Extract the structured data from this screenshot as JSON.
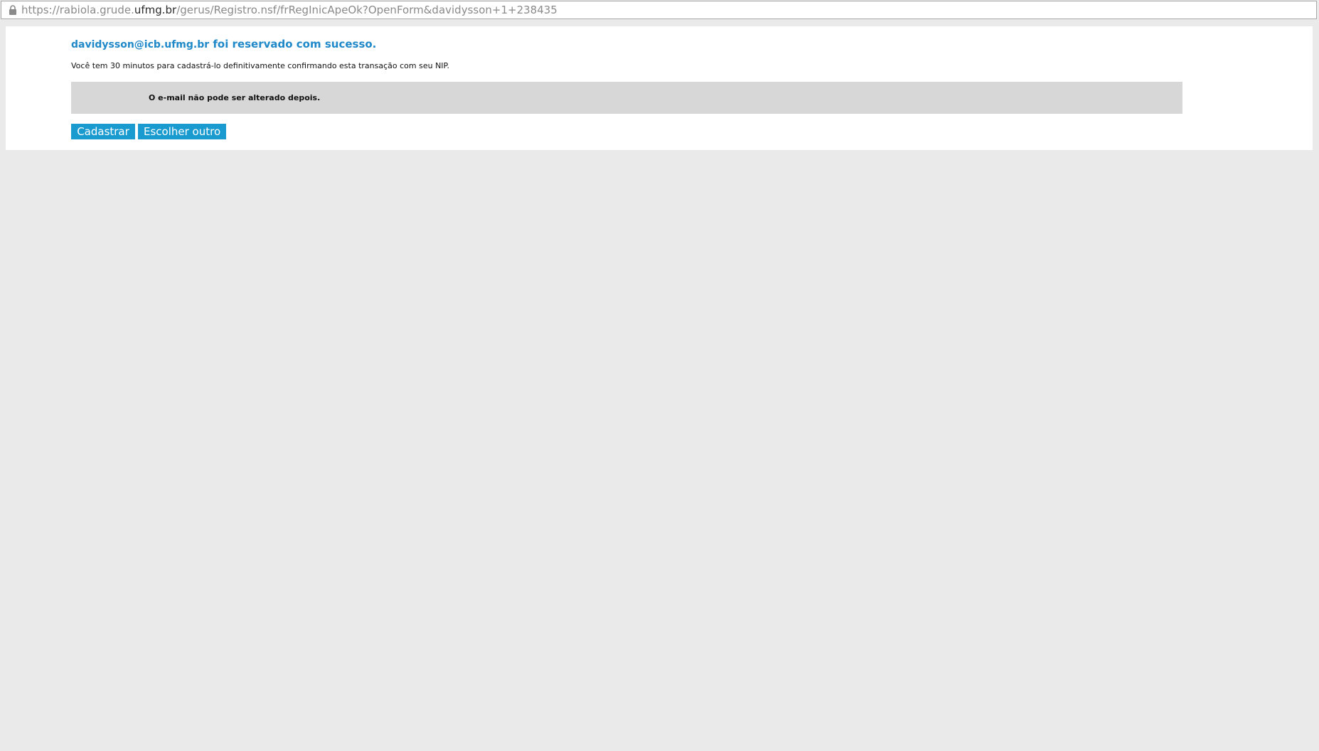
{
  "browser": {
    "url_prefix": "https://rabiola.grude.",
    "url_domain": "ufmg.br",
    "url_suffix": "/gerus/Registro.nsf/frRegInicApeOk?OpenForm&davidysson+1+238435",
    "lock_icon": "lock-icon"
  },
  "page": {
    "title_email": "davidysson@icb.ufmg.br",
    "title_rest": " foi reservado com sucesso.",
    "subtext": "Você tem 30 minutos para cadastrá-lo definitivamente confirmando esta transação com seu NIP.",
    "notice": "O e-mail não pode ser alterado depois.",
    "buttons": {
      "cadastrar": "Cadastrar",
      "escolher": "Escolher outro"
    }
  },
  "colors": {
    "accent": "#1a9bd0",
    "title": "#1e88c8",
    "notice_bg": "#d7d7d7",
    "page_bg": "#eaeaea"
  }
}
